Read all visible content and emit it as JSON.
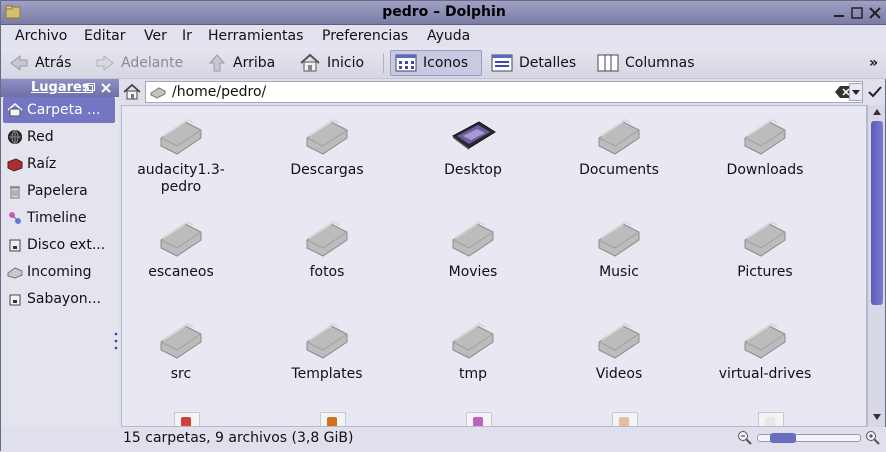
{
  "window": {
    "title": "pedro – Dolphin"
  },
  "menu": [
    "Archivo",
    "Editar",
    "Ver",
    "Ir",
    "Herramientas",
    "Preferencias",
    "Ayuda"
  ],
  "toolbar": {
    "back": "Atrás",
    "forward": "Adelante",
    "up": "Arriba",
    "home": "Inicio",
    "icons": "Iconos",
    "details": "Detalles",
    "columns": "Columnas",
    "overflow": "»"
  },
  "sidebar": {
    "title": "Lugares",
    "items": [
      {
        "label": "Carpeta ...",
        "icon": "home-icon",
        "selected": true
      },
      {
        "label": "Red",
        "icon": "network-icon"
      },
      {
        "label": "Raíz",
        "icon": "root-folder-icon"
      },
      {
        "label": "Papelera",
        "icon": "trash-icon"
      },
      {
        "label": "Timeline",
        "icon": "timeline-icon"
      },
      {
        "label": "Disco ext...",
        "icon": "external-disk-icon"
      },
      {
        "label": "Incoming",
        "icon": "incoming-icon"
      },
      {
        "label": "Sabayon...",
        "icon": "removable-disk-icon"
      }
    ]
  },
  "location": {
    "path": "/home/pedro/"
  },
  "files": [
    {
      "name": "audacity1.3-pedro",
      "icon": "folder-icon"
    },
    {
      "name": "Descargas",
      "icon": "folder-icon"
    },
    {
      "name": "Desktop",
      "icon": "desktop-folder-icon"
    },
    {
      "name": "Documents",
      "icon": "folder-icon"
    },
    {
      "name": "Downloads",
      "icon": "folder-icon"
    },
    {
      "name": "escaneos",
      "icon": "folder-icon"
    },
    {
      "name": "fotos",
      "icon": "folder-icon"
    },
    {
      "name": "Movies",
      "icon": "folder-icon"
    },
    {
      "name": "Music",
      "icon": "folder-icon"
    },
    {
      "name": "Pictures",
      "icon": "folder-icon"
    },
    {
      "name": "src",
      "icon": "folder-icon"
    },
    {
      "name": "Templates",
      "icon": "folder-icon"
    },
    {
      "name": "tmp",
      "icon": "folder-icon"
    },
    {
      "name": "Videos",
      "icon": "folder-icon"
    },
    {
      "name": "virtual-drives",
      "icon": "folder-icon"
    }
  ],
  "status": {
    "text": "15 carpetas, 9 archivos (3,8 GiB)"
  },
  "colors": {
    "titlebar": "#8a8cb8",
    "selection": "#7476c4",
    "scroll_thumb": "#6a6cc0"
  }
}
